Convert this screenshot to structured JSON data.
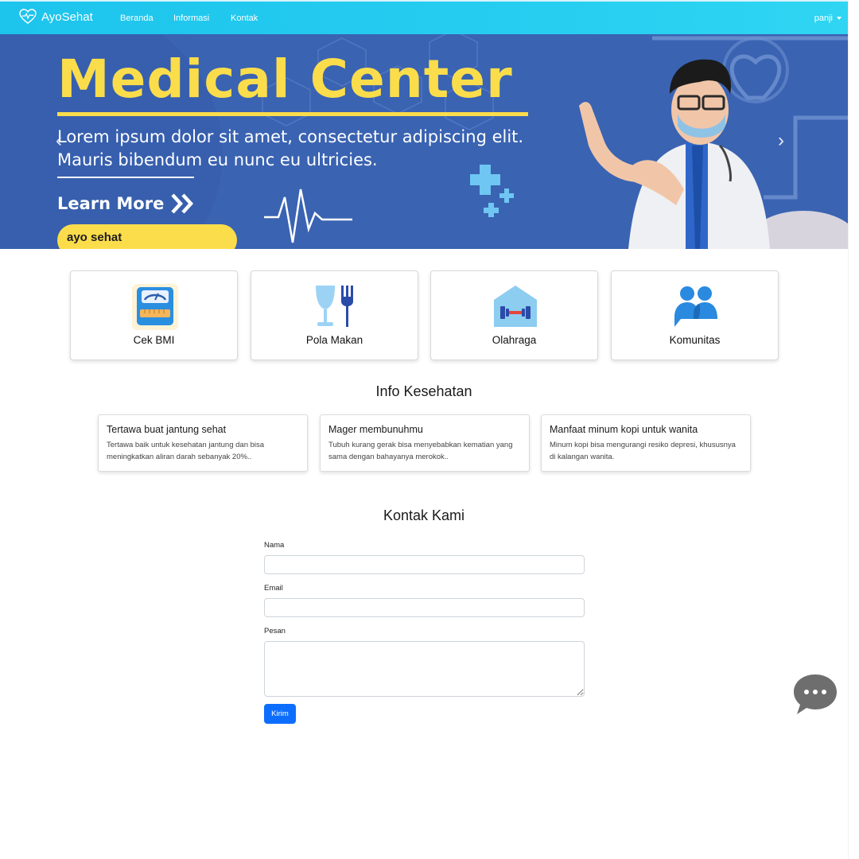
{
  "navbar": {
    "brand": "AyoSehat",
    "links": [
      "Beranda",
      "Informasi",
      "Kontak"
    ],
    "user": "panji"
  },
  "hero": {
    "title": "Medical Center",
    "subtitle_line1": "Lorem ipsum dolor sit amet, consectetur adipiscing elit.",
    "subtitle_line2": "Mauris bibendum eu nunc eu ultricies.",
    "cta": "Learn More",
    "pill": "ayo sehat"
  },
  "features": [
    {
      "label": "Cek BMI",
      "icon": "bmi-scale-icon"
    },
    {
      "label": "Pola Makan",
      "icon": "glass-fork-icon"
    },
    {
      "label": "Olahraga",
      "icon": "gym-dumbbell-icon"
    },
    {
      "label": "Komunitas",
      "icon": "community-icon"
    }
  ],
  "info": {
    "title": "Info Kesehatan",
    "cards": [
      {
        "title": "Tertawa buat jantung sehat",
        "text": "Tertawa baik untuk kesehatan jantung dan bisa meningkatkan aliran darah sebanyak 20%.."
      },
      {
        "title": "Mager membunuhmu",
        "text": "Tubuh kurang gerak bisa menyebabkan kematian yang sama dengan bahayanya merokok.."
      },
      {
        "title": "Manfaat minum kopi untuk wanita",
        "text": "Minum kopi bisa mengurangi resiko depresi, khususnya di kalangan wanita."
      }
    ]
  },
  "contact": {
    "title": "Kontak Kami",
    "name_label": "Nama",
    "name_value": "",
    "email_label": "Email",
    "email_value": "",
    "message_label": "Pesan",
    "message_value": "",
    "submit": "Kirim"
  },
  "colors": {
    "navbar": "#27cdf0",
    "hero_bg": "#3a63b2",
    "hero_accent": "#fbdd4b",
    "primary_button": "#0d6efd"
  }
}
